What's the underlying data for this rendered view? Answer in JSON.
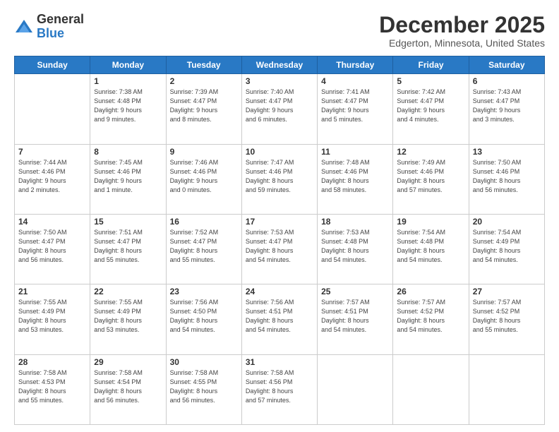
{
  "logo": {
    "general": "General",
    "blue": "Blue"
  },
  "header": {
    "month": "December 2025",
    "location": "Edgerton, Minnesota, United States"
  },
  "days_of_week": [
    "Sunday",
    "Monday",
    "Tuesday",
    "Wednesday",
    "Thursday",
    "Friday",
    "Saturday"
  ],
  "weeks": [
    [
      {
        "day": "",
        "info": ""
      },
      {
        "day": "1",
        "info": "Sunrise: 7:38 AM\nSunset: 4:48 PM\nDaylight: 9 hours\nand 9 minutes."
      },
      {
        "day": "2",
        "info": "Sunrise: 7:39 AM\nSunset: 4:47 PM\nDaylight: 9 hours\nand 8 minutes."
      },
      {
        "day": "3",
        "info": "Sunrise: 7:40 AM\nSunset: 4:47 PM\nDaylight: 9 hours\nand 6 minutes."
      },
      {
        "day": "4",
        "info": "Sunrise: 7:41 AM\nSunset: 4:47 PM\nDaylight: 9 hours\nand 5 minutes."
      },
      {
        "day": "5",
        "info": "Sunrise: 7:42 AM\nSunset: 4:47 PM\nDaylight: 9 hours\nand 4 minutes."
      },
      {
        "day": "6",
        "info": "Sunrise: 7:43 AM\nSunset: 4:47 PM\nDaylight: 9 hours\nand 3 minutes."
      }
    ],
    [
      {
        "day": "7",
        "info": "Sunrise: 7:44 AM\nSunset: 4:46 PM\nDaylight: 9 hours\nand 2 minutes."
      },
      {
        "day": "8",
        "info": "Sunrise: 7:45 AM\nSunset: 4:46 PM\nDaylight: 9 hours\nand 1 minute."
      },
      {
        "day": "9",
        "info": "Sunrise: 7:46 AM\nSunset: 4:46 PM\nDaylight: 9 hours\nand 0 minutes."
      },
      {
        "day": "10",
        "info": "Sunrise: 7:47 AM\nSunset: 4:46 PM\nDaylight: 8 hours\nand 59 minutes."
      },
      {
        "day": "11",
        "info": "Sunrise: 7:48 AM\nSunset: 4:46 PM\nDaylight: 8 hours\nand 58 minutes."
      },
      {
        "day": "12",
        "info": "Sunrise: 7:49 AM\nSunset: 4:46 PM\nDaylight: 8 hours\nand 57 minutes."
      },
      {
        "day": "13",
        "info": "Sunrise: 7:50 AM\nSunset: 4:46 PM\nDaylight: 8 hours\nand 56 minutes."
      }
    ],
    [
      {
        "day": "14",
        "info": "Sunrise: 7:50 AM\nSunset: 4:47 PM\nDaylight: 8 hours\nand 56 minutes."
      },
      {
        "day": "15",
        "info": "Sunrise: 7:51 AM\nSunset: 4:47 PM\nDaylight: 8 hours\nand 55 minutes."
      },
      {
        "day": "16",
        "info": "Sunrise: 7:52 AM\nSunset: 4:47 PM\nDaylight: 8 hours\nand 55 minutes."
      },
      {
        "day": "17",
        "info": "Sunrise: 7:53 AM\nSunset: 4:47 PM\nDaylight: 8 hours\nand 54 minutes."
      },
      {
        "day": "18",
        "info": "Sunrise: 7:53 AM\nSunset: 4:48 PM\nDaylight: 8 hours\nand 54 minutes."
      },
      {
        "day": "19",
        "info": "Sunrise: 7:54 AM\nSunset: 4:48 PM\nDaylight: 8 hours\nand 54 minutes."
      },
      {
        "day": "20",
        "info": "Sunrise: 7:54 AM\nSunset: 4:49 PM\nDaylight: 8 hours\nand 54 minutes."
      }
    ],
    [
      {
        "day": "21",
        "info": "Sunrise: 7:55 AM\nSunset: 4:49 PM\nDaylight: 8 hours\nand 53 minutes."
      },
      {
        "day": "22",
        "info": "Sunrise: 7:55 AM\nSunset: 4:49 PM\nDaylight: 8 hours\nand 53 minutes."
      },
      {
        "day": "23",
        "info": "Sunrise: 7:56 AM\nSunset: 4:50 PM\nDaylight: 8 hours\nand 54 minutes."
      },
      {
        "day": "24",
        "info": "Sunrise: 7:56 AM\nSunset: 4:51 PM\nDaylight: 8 hours\nand 54 minutes."
      },
      {
        "day": "25",
        "info": "Sunrise: 7:57 AM\nSunset: 4:51 PM\nDaylight: 8 hours\nand 54 minutes."
      },
      {
        "day": "26",
        "info": "Sunrise: 7:57 AM\nSunset: 4:52 PM\nDaylight: 8 hours\nand 54 minutes."
      },
      {
        "day": "27",
        "info": "Sunrise: 7:57 AM\nSunset: 4:52 PM\nDaylight: 8 hours\nand 55 minutes."
      }
    ],
    [
      {
        "day": "28",
        "info": "Sunrise: 7:58 AM\nSunset: 4:53 PM\nDaylight: 8 hours\nand 55 minutes."
      },
      {
        "day": "29",
        "info": "Sunrise: 7:58 AM\nSunset: 4:54 PM\nDaylight: 8 hours\nand 56 minutes."
      },
      {
        "day": "30",
        "info": "Sunrise: 7:58 AM\nSunset: 4:55 PM\nDaylight: 8 hours\nand 56 minutes."
      },
      {
        "day": "31",
        "info": "Sunrise: 7:58 AM\nSunset: 4:56 PM\nDaylight: 8 hours\nand 57 minutes."
      },
      {
        "day": "",
        "info": ""
      },
      {
        "day": "",
        "info": ""
      },
      {
        "day": "",
        "info": ""
      }
    ]
  ]
}
